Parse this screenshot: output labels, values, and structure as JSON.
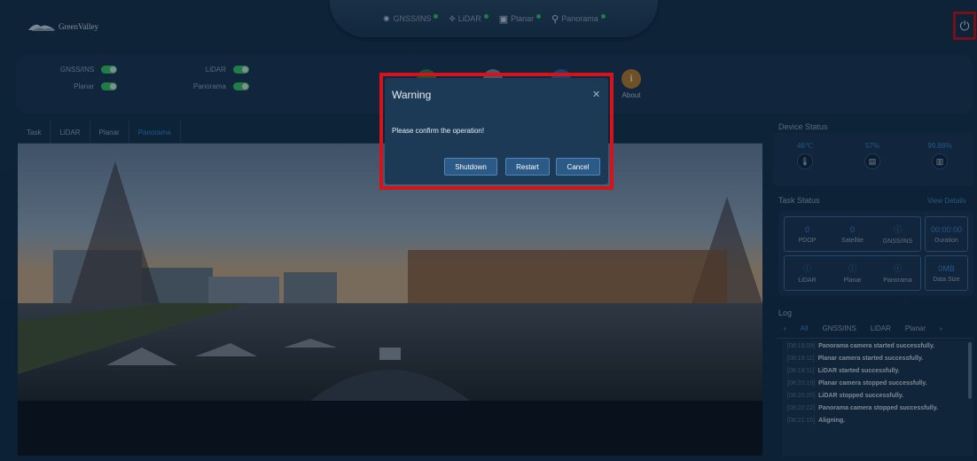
{
  "app": {
    "brand": "GreenValley"
  },
  "status_tabs": [
    {
      "label": "GNSS/INS",
      "icon": "satellite-icon"
    },
    {
      "label": "LiDAR",
      "icon": "lidar-icon"
    },
    {
      "label": "Planar",
      "icon": "camera-icon"
    },
    {
      "label": "Panorama",
      "icon": "panorama-icon"
    }
  ],
  "controls": {
    "toggles": [
      {
        "label": "GNSS/INS"
      },
      {
        "label": "Planar"
      },
      {
        "label": "LiDAR"
      },
      {
        "label": "Panorama"
      }
    ],
    "about_label": "About"
  },
  "view_tabs": [
    "Task",
    "LiDAR",
    "Planar",
    "Panorama"
  ],
  "device_status": {
    "title": "Device Status",
    "items": [
      {
        "value": "46℃",
        "icon": "temperature-icon"
      },
      {
        "value": "57%",
        "icon": "storage-icon"
      },
      {
        "value": "99.88%",
        "icon": "disk-icon"
      }
    ]
  },
  "task_status": {
    "title": "Task Status",
    "view_details": "View Details",
    "row1": [
      {
        "value": "0",
        "label": "PDOP"
      },
      {
        "value": "0",
        "label": "Satellite"
      },
      {
        "value": "ⓘ",
        "label": "GNSS/INS"
      }
    ],
    "duration": {
      "value": "00:00:00",
      "label": "Duration"
    },
    "row2": [
      {
        "value": "ⓘ",
        "label": "LiDAR"
      },
      {
        "value": "ⓘ",
        "label": "Planar"
      },
      {
        "value": "ⓘ",
        "label": "Panorama"
      }
    ],
    "data_size": {
      "value": "0MB",
      "label": "Data Size"
    }
  },
  "log": {
    "title": "Log",
    "tabs": [
      "All",
      "GNSS/INS",
      "LiDAR",
      "Planar"
    ],
    "entries": [
      {
        "time": "[08:18:09]",
        "msg": "Panorama camera started successfully."
      },
      {
        "time": "[08:18:11]",
        "msg": "Planar camera started successfully."
      },
      {
        "time": "[08:18:11]",
        "msg": "LiDAR started successfully."
      },
      {
        "time": "[08:20:19]",
        "msg": "Planar camera stopped successfully."
      },
      {
        "time": "[08:20:20]",
        "msg": "LiDAR stopped successfully."
      },
      {
        "time": "[08:20:22]",
        "msg": "Panorama camera stopped successfully."
      },
      {
        "time": "[08:21:15]",
        "msg": "Aligning."
      }
    ]
  },
  "modal": {
    "title": "Warning",
    "message": "Please confirm the operation!",
    "buttons": {
      "shutdown": "Shutdown",
      "restart": "Restart",
      "cancel": "Cancel"
    }
  }
}
